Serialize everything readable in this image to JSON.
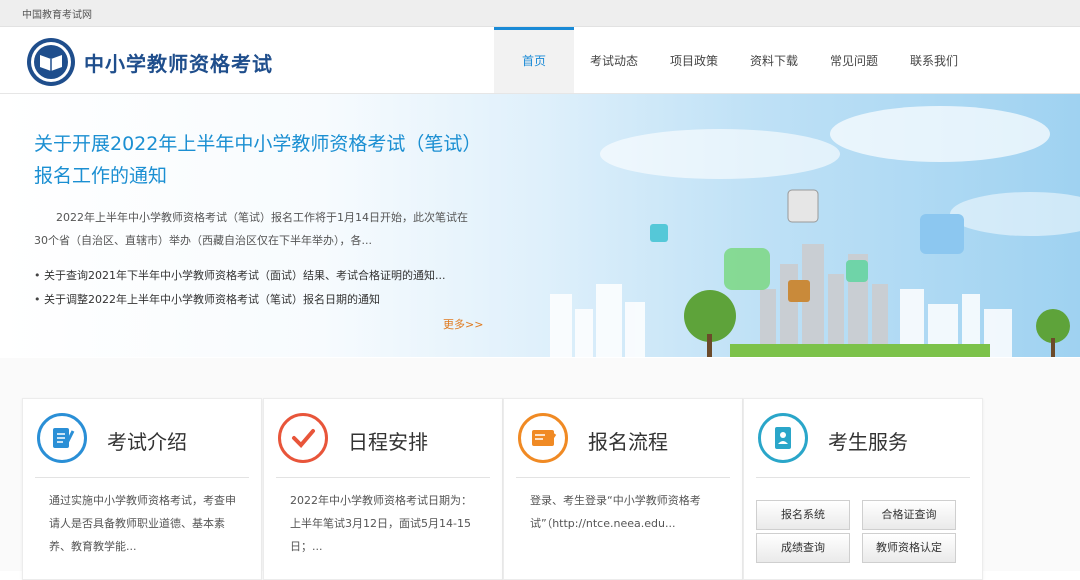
{
  "topbar": {
    "text": "中国教育考试网"
  },
  "header": {
    "site_title": "中小学教师资格考试",
    "nav": [
      {
        "label": "首页",
        "active": true
      },
      {
        "label": "考试动态"
      },
      {
        "label": "项目政策"
      },
      {
        "label": "资料下载"
      },
      {
        "label": "常见问题"
      },
      {
        "label": "联系我们"
      }
    ]
  },
  "banner": {
    "headline": "关于开展2022年上半年中小学教师资格考试（笔试）报名工作的通知",
    "summary": "2022年上半年中小学教师资格考试（笔试）报名工作将于1月14日开始，此次笔试在30个省（自治区、直辖市）举办（西藏自治区仅在下半年举办），各...",
    "news": [
      "关于查询2021年下半年中小学教师资格考试（面试）结果、考试合格证明的通知...",
      "关于调整2022年上半年中小学教师资格考试（笔试）报名日期的通知"
    ],
    "more": "更多>>"
  },
  "cards": [
    {
      "title": "考试介绍",
      "text": "通过实施中小学教师资格考试，考查申请人是否具备教师职业道德、基本素养、教育教学能...",
      "color": "#2a8fd6"
    },
    {
      "title": "日程安排",
      "text": "2022年中小学教师资格考试日期为：上半年笔试3月12日，面试5月14-15日；...",
      "color": "#e8553a"
    },
    {
      "title": "报名流程",
      "text": "登录、考生登录“中小学教师资格考试”（http://ntce.neea.edu...",
      "color": "#f08a24"
    },
    {
      "title": "考生服务",
      "color": "#2aa6c9"
    }
  ],
  "services": [
    "报名系统",
    "合格证查询",
    "成绩查询",
    "教师资格认定"
  ],
  "colors": {
    "accent": "#1a8ad6",
    "title": "#1b8fd2",
    "brand": "#1f4e8c",
    "more": "#e07a1f"
  }
}
